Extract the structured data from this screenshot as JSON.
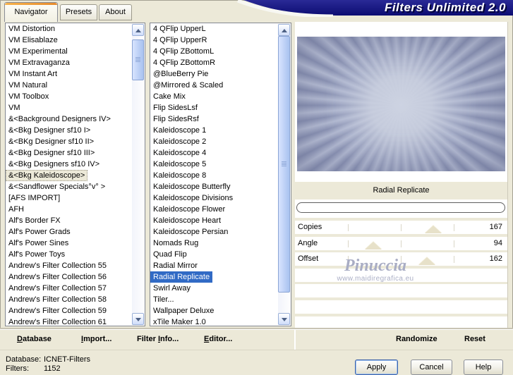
{
  "window": {
    "title": "Filters Unlimited 2.0"
  },
  "tabs": [
    {
      "label": "Navigator",
      "active": true
    },
    {
      "label": "Presets",
      "active": false
    },
    {
      "label": "About",
      "active": false
    }
  ],
  "category_list": {
    "selected": "&<Bkg Kaleidoscope>",
    "items": [
      "VM Distortion",
      "VM Elisablaze",
      "VM Experimental",
      "VM Extravaganza",
      "VM Instant Art",
      "VM Natural",
      "VM Toolbox",
      "VM",
      "&<Background Designers IV>",
      "&<Bkg Designer sf10 I>",
      "&<BKg Designer sf10 II>",
      "&<Bkg Designer sf10 III>",
      "&<Bkg Designers sf10 IV>",
      "&<Bkg Kaleidoscope>",
      "&<Sandflower Specials°v° >",
      "[AFS IMPORT]",
      "AFH",
      "Alf's Border FX",
      "Alf's Power Grads",
      "Alf's Power Sines",
      "Alf's Power Toys",
      "Andrew's Filter Collection 55",
      "Andrew's Filter Collection 56",
      "Andrew's Filter Collection 57",
      "Andrew's Filter Collection 58",
      "Andrew's Filter Collection 59",
      "Andrew's Filter Collection 61"
    ]
  },
  "filter_list": {
    "selected": "Radial Replicate",
    "items": [
      "4 QFlip UpperL",
      "4 QFlip UpperR",
      "4 QFlip ZBottomL",
      "4 QFlip ZBottomR",
      "@BlueBerry Pie",
      "@Mirrored & Scaled",
      "Cake Mix",
      "Flip SidesLsf",
      "Flip SidesRsf",
      "Kaleidoscope 1",
      "Kaleidoscope 2",
      "Kaleidoscope 4",
      "Kaleidoscope 5",
      "Kaleidoscope 8",
      "Kaleidoscope Butterfly",
      "Kaleidoscope Divisions",
      "Kaleidoscope Flower",
      "Kaleidoscope Heart",
      "Kaleidoscope Persian",
      "Nomads Rug",
      "Quad Flip",
      "Radial Mirror",
      "Radial Replicate",
      "Swirl Away",
      "Tiler...",
      "Wallpaper Deluxe",
      "xTile Maker 1.0"
    ]
  },
  "preview": {
    "filter_name": "Radial Replicate",
    "watermark": {
      "name": "Pinuccia",
      "url": "www.maidiregrafica.eu"
    }
  },
  "parameters": [
    {
      "label": "Copies",
      "value": "167",
      "percent": 65
    },
    {
      "label": "Angle",
      "value": "94",
      "percent": 37
    },
    {
      "label": "Offset",
      "value": "162",
      "percent": 62
    }
  ],
  "parameters_empty_rows": 4,
  "toolbar": {
    "left": [
      {
        "label": "Database",
        "accel": 0
      },
      {
        "label": "Import...",
        "accel": 0
      },
      {
        "label": "Filter Info...",
        "accel": 7
      },
      {
        "label": "Editor...",
        "accel": 0
      }
    ],
    "right": [
      {
        "label": "Randomize",
        "accel": null
      },
      {
        "label": "Reset",
        "accel": null
      }
    ]
  },
  "status": {
    "database_label": "Database:",
    "database_value": "ICNET-Filters",
    "filters_label": "Filters:",
    "filters_value": "1152"
  },
  "actions": {
    "apply": "Apply",
    "cancel": "Cancel",
    "help": "Help"
  },
  "colors": {
    "window_bg": "#ece9d8",
    "banner_navy": "#12127c",
    "selection_blue": "#316ac5",
    "active_tab_orange": "#e68b2c",
    "preview_ray_dark": "#878fb0",
    "preview_ray_light": "#b4bbd2",
    "preview_center": "#cdd3e2",
    "watermark": "#a9adc4"
  }
}
